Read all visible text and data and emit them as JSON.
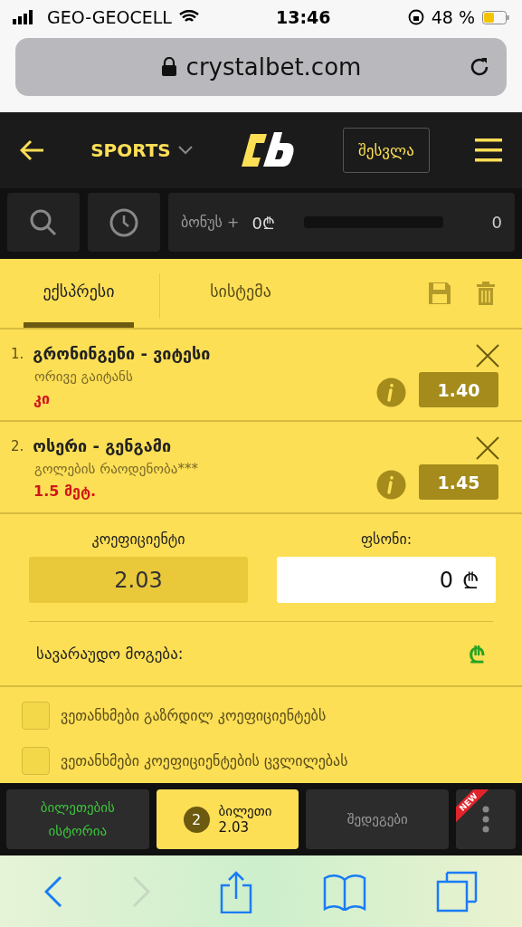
{
  "status_bar": {
    "carrier": "GEO-GEOCELL",
    "time": "13:46",
    "battery": "48 %"
  },
  "address_bar": {
    "url": "crystalbet.com"
  },
  "header": {
    "sports": "SPORTS",
    "login": "შესვლა"
  },
  "toolbar": {
    "bonus_label": "ბონუს +",
    "bonus_value": "0₾",
    "progress_value": "0"
  },
  "tabs": [
    {
      "label": "ექსპრესი",
      "selected": true
    },
    {
      "label": "სისტემა",
      "selected": false
    }
  ],
  "bets": [
    {
      "number": "1.",
      "match": "გრონინგენი - ვიტესი",
      "market": "ორივე გაიტანს",
      "pick": "კი",
      "odds": "1.40"
    },
    {
      "number": "2.",
      "match": "ოსერი - გენგამი",
      "market": "გოლების რაოდენობა***",
      "pick": "1.5 მეტ.",
      "odds": "1.45"
    }
  ],
  "summary": {
    "coef_label": "კოეფიციენტი",
    "coef_value": "2.03",
    "stake_label": "ფსონი:",
    "stake_value": "0",
    "currency": "₾",
    "win_label": "სავარაუდო მოგება:",
    "win_currency": "₾"
  },
  "options": [
    {
      "label": "ვეთანხმები გაზრდილ კოეფიციენტებს",
      "checked": false
    },
    {
      "label": "ვეთანხმები კოეფიციენტების ცვლილებას",
      "checked": false
    }
  ],
  "bottom_nav": [
    {
      "kind": "text",
      "label": "ბილეთების ისტორია",
      "selected": false
    },
    {
      "kind": "ticket",
      "count": "2",
      "label": "ბილეთი",
      "value": "2.03",
      "selected": true
    },
    {
      "kind": "text",
      "label": "შედეგები",
      "selected": false
    },
    {
      "kind": "more",
      "badge": "NEW",
      "selected": false
    }
  ]
}
